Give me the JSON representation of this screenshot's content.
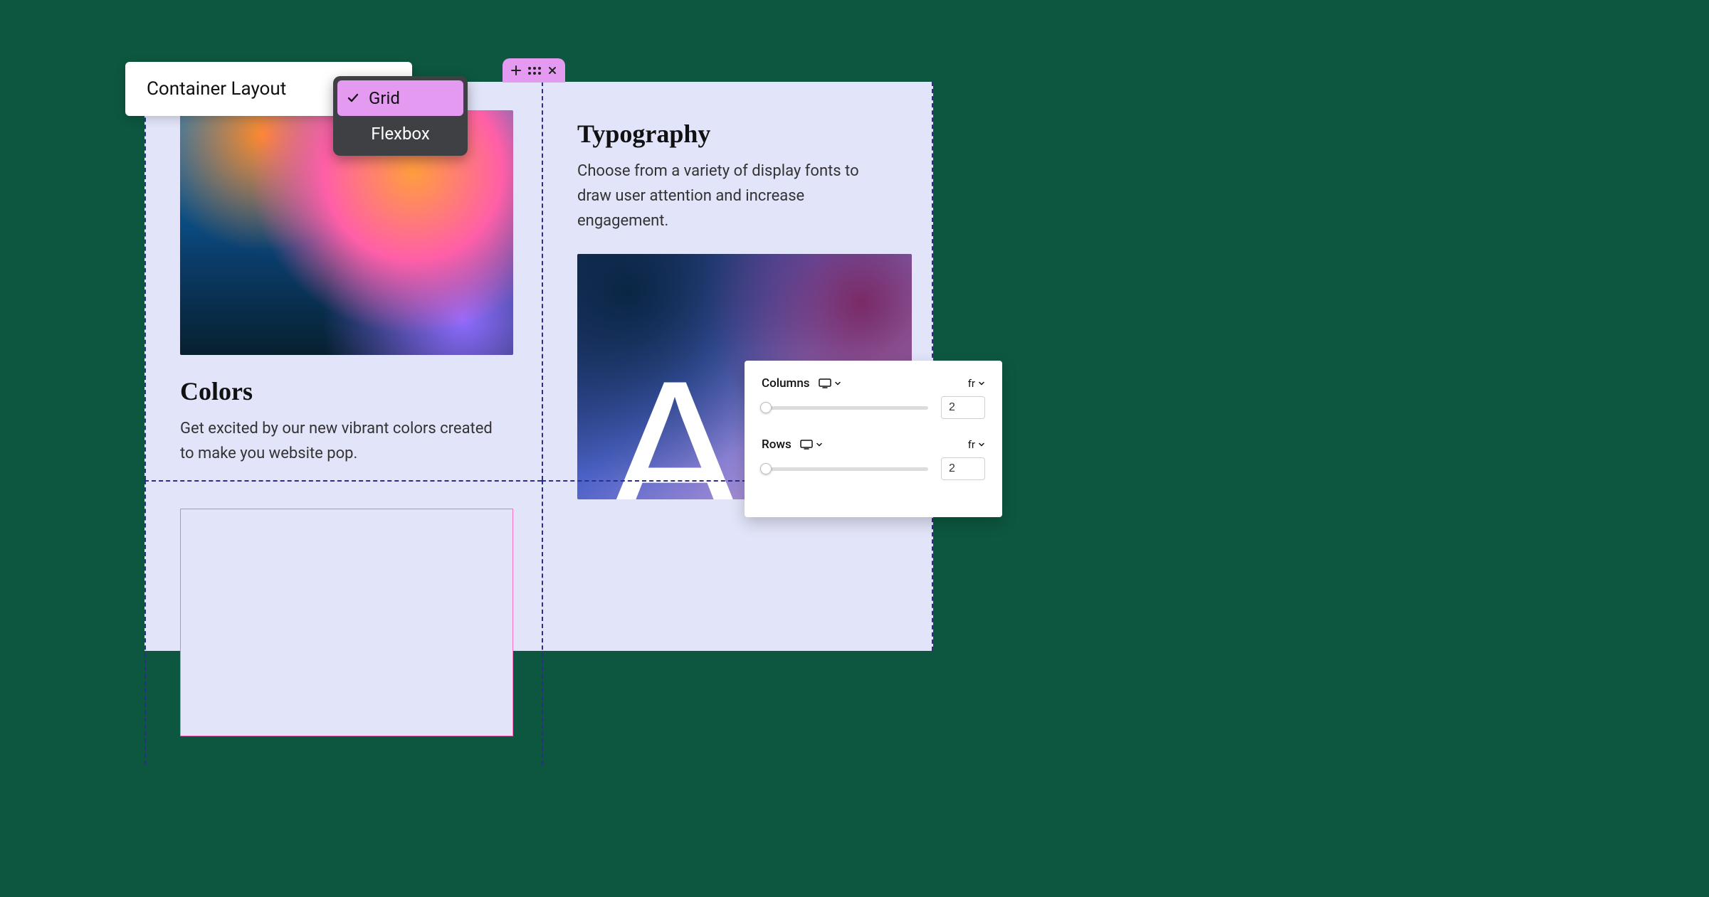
{
  "layout_popover": {
    "title": "Container Layout"
  },
  "layout_dropdown": {
    "options": [
      {
        "label": "Grid",
        "selected": true
      },
      {
        "label": "Flexbox",
        "selected": false
      }
    ]
  },
  "handle": {
    "icons": [
      "plus-icon",
      "drag-grip-icon",
      "close-icon"
    ]
  },
  "cells": {
    "colors": {
      "heading": "Colors",
      "body": "Get excited by our new vibrant colors created to make you website pop."
    },
    "typography": {
      "heading": "Typography",
      "body": "Choose from a variety of display fonts to draw user attention and increase engagement.",
      "glyphs": "Ab"
    }
  },
  "grid_panel": {
    "columns": {
      "label": "Columns",
      "unit": "fr",
      "value": "2"
    },
    "rows": {
      "label": "Rows",
      "unit": "fr",
      "value": "2"
    },
    "device_icon": "desktop-icon"
  },
  "colors": {
    "background": "#0d5740",
    "canvas": "#e2e4f9",
    "accent_pink": "#e49af0",
    "dropdown_bg": "#3f4043"
  }
}
